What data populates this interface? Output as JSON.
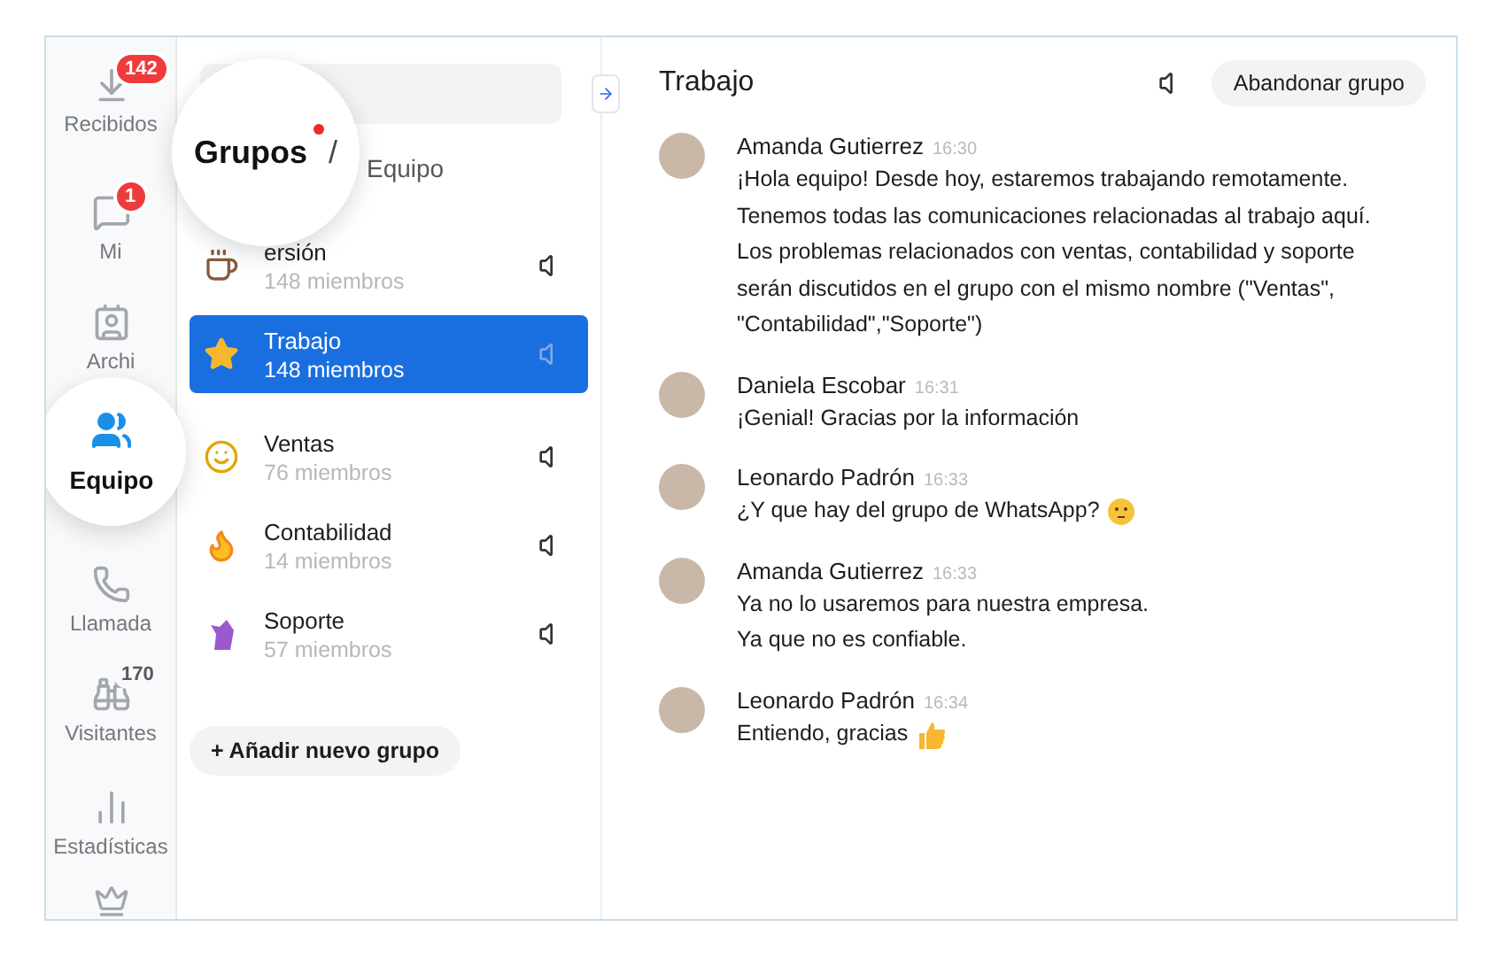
{
  "nav": [
    {
      "label": "Recibidos",
      "badge": {
        "text": "142",
        "kind": "alert"
      },
      "selected": false
    },
    {
      "label": "Mi",
      "badge": {
        "text": "1",
        "kind": "alert"
      },
      "selected": false
    },
    {
      "label": "Archi",
      "selected": false
    },
    {
      "label": "Equipo",
      "selected": true
    },
    {
      "label": "Llamada",
      "selected": false
    },
    {
      "label": "Visitantes",
      "badge": {
        "text": "170",
        "kind": "plain"
      },
      "selected": false
    },
    {
      "label": "Estadísticas",
      "selected": false
    }
  ],
  "breadcrumb": {
    "title": "Grupos",
    "unread": true,
    "separator": "/",
    "current": "Equipo"
  },
  "groups": [
    {
      "name": "ersión",
      "members": "148 miembros",
      "selected": false
    },
    {
      "name": "Trabajo",
      "members": "148 miembros",
      "selected": true
    },
    {
      "name": "Ventas",
      "members": "76 miembros",
      "selected": false
    },
    {
      "name": "Contabilidad",
      "members": "14 miembros",
      "selected": false
    },
    {
      "name": "Soporte",
      "members": "57 miembros",
      "selected": false
    }
  ],
  "add_group_button": "+ Añadir nuevo grupo",
  "chat": {
    "title": "Trabajo",
    "leave_button": "Abandonar grupo",
    "messages": [
      {
        "kind": "text",
        "author": "Amanda Gutierrez",
        "time": "16:30",
        "lines": [
          "¡Hola equipo! Desde hoy, estaremos trabajando remotamente.",
          "Tenemos todas las comunicaciones relacionadas al trabajo aquí.",
          "Los problemas relacionados con ventas, contabilidad y soporte",
          "serán discutidos en el grupo con el mismo nombre (\"Ventas\",",
          "\"Contabilidad\",\"Soporte\")"
        ]
      },
      {
        "kind": "text",
        "author": "Daniela Escobar",
        "time": "16:31",
        "lines": [
          "¡Genial! Gracias por la información"
        ]
      },
      {
        "kind": "thinking",
        "author": "Leonardo Padrón",
        "time": "16:33",
        "lines": [
          "¿Y que hay del grupo de WhatsApp?"
        ]
      },
      {
        "kind": "text",
        "author": "Amanda Gutierrez",
        "time": "16:33",
        "lines": [
          "Ya no lo usaremos para nuestra empresa.",
          "Ya que no es confiable."
        ]
      },
      {
        "kind": "thumbs_up",
        "author": "Leonardo Padrón",
        "time": "16:34",
        "lines": [
          "Entiendo, gracias"
        ]
      }
    ]
  }
}
